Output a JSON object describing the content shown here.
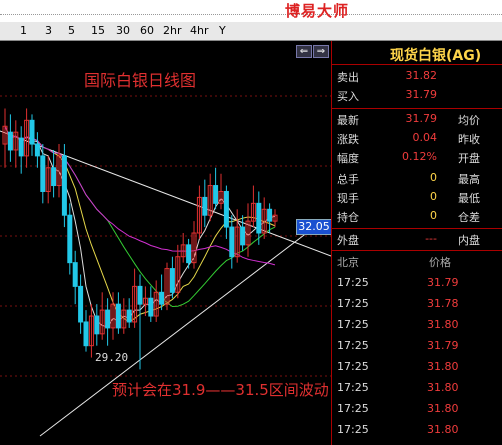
{
  "banner": {
    "title": "博易大师"
  },
  "toolbar": {
    "periods": [
      "1",
      "3",
      "5",
      "15",
      "30",
      "60",
      "2hr",
      "4hr",
      "Y"
    ]
  },
  "chart": {
    "title": "国际白银日线图",
    "annotation": "预计会在31.9——31.5区间波动",
    "low_label": "29.20",
    "price_tag": "32.05",
    "arrow_left": "⇐",
    "arrow_right": "⇒",
    "colors": {
      "up": "#e03030",
      "down": "#22c8e8",
      "ma_white": "#dddddd",
      "ma_yellow": "#e6d84a",
      "ma_green": "#33cc33",
      "ma_magenta": "#d030d0"
    }
  },
  "quote": {
    "instrument": "现货白银(AG)",
    "sell_label": "卖出",
    "sell": "31.82",
    "buy_label": "买入",
    "buy": "31.79",
    "last_label": "最新",
    "last": "31.79",
    "avg_label": "均价",
    "change_label": "涨跌",
    "change": "0.04",
    "prev_close_label": "昨收",
    "range_label": "幅度",
    "range": "0.12%",
    "open_label": "开盘",
    "total_label": "总手",
    "total": "0",
    "high_label": "最高",
    "current_label": "现手",
    "current": "0",
    "low_label": "最低",
    "oi_label": "持仓",
    "oi": "0",
    "oi_diff_label": "仓差",
    "outer_label": "外盘",
    "outer": "---",
    "inner_label": "内盘",
    "ticks_header": {
      "time": "北京",
      "price": "价格"
    },
    "ticks": [
      {
        "time": "17:25",
        "price": "31.79"
      },
      {
        "time": "17:25",
        "price": "31.78"
      },
      {
        "time": "17:25",
        "price": "31.80"
      },
      {
        "time": "17:25",
        "price": "31.79"
      },
      {
        "time": "17:25",
        "price": "31.80"
      },
      {
        "time": "17:25",
        "price": "31.80"
      },
      {
        "time": "17:25",
        "price": "31.80"
      },
      {
        "time": "17:25",
        "price": "31.80"
      }
    ]
  }
}
